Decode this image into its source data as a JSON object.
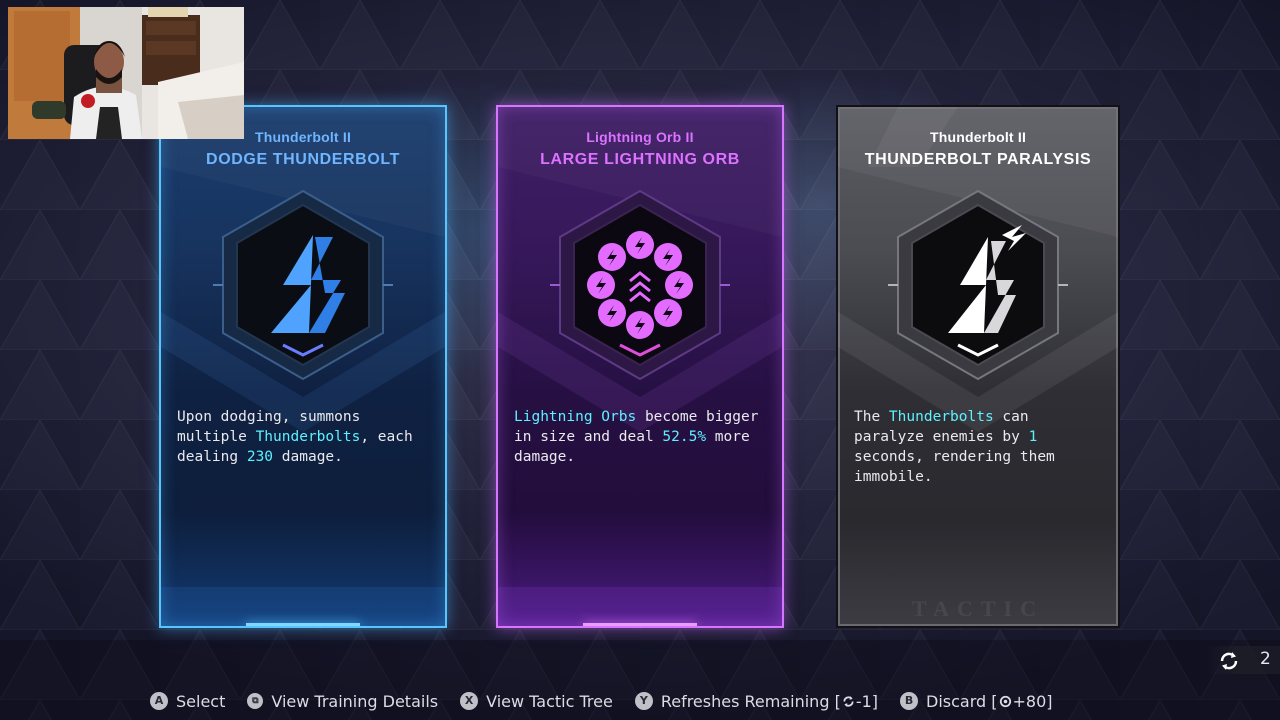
{
  "cards": [
    {
      "subtitle": "Thunderbolt II",
      "title": "DODGE THUNDERBOLT",
      "icon": "lightning-bolt-icon",
      "accent": "#57c6ff",
      "desc": {
        "t1": "Upon dodging, summons multiple ",
        "h1": "Thunderbolts",
        "t2": ", each dealing ",
        "h2": "230",
        "t3": " damage."
      }
    },
    {
      "subtitle": "Lightning Orb II",
      "title": "LARGE LIGHTNING ORB",
      "icon": "lightning-orbs-ring-icon",
      "accent": "#d676ff",
      "desc": {
        "h1": "Lightning Orbs",
        "t1": " become bigger in size and deal ",
        "h2": "52.5%",
        "t2": " more damage."
      }
    },
    {
      "subtitle": "Thunderbolt II",
      "title": "THUNDERBOLT PARALYSIS",
      "icon": "thunderbolt-paralysis-icon",
      "accent": "#ffffff",
      "watermark": "TACTIC",
      "desc": {
        "t1": "The ",
        "h1": "Thunderbolts",
        "t2": " can paralyze enemies by ",
        "h2": "1",
        "t3": " seconds, rendering them immobile."
      }
    }
  ],
  "refresh_counter": {
    "icon": "refresh-icon",
    "count": "2"
  },
  "hints": [
    {
      "button": "A",
      "label": "Select"
    },
    {
      "button": "view",
      "label": "View Training Details"
    },
    {
      "button": "X",
      "label": "View Tactic Tree"
    },
    {
      "button": "Y",
      "label": "Refreshes Remaining [",
      "cost": "-1]"
    },
    {
      "button": "B",
      "label": "Discard [",
      "cost": "+80]"
    }
  ],
  "colors": {
    "highlight": "#5ff0ff",
    "card1_border": "#57c6ff",
    "card2_border": "#d676ff",
    "card3_border": "#111116"
  }
}
